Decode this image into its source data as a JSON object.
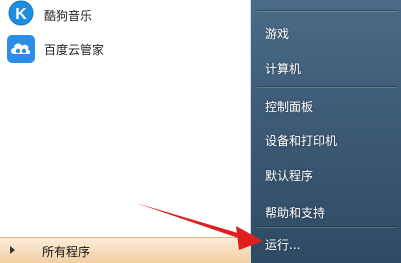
{
  "programs": [
    {
      "label": "酷狗音乐",
      "icon": "kugou-music-icon"
    },
    {
      "label": "百度云管家",
      "icon": "baidu-cloud-icon"
    }
  ],
  "all_programs": {
    "label": "所有程序",
    "icon": "triangle-right-icon"
  },
  "right_menu": [
    {
      "label": "游戏"
    },
    {
      "label": "计算机"
    },
    {
      "label": "控制面板"
    },
    {
      "label": "设备和打印机"
    },
    {
      "label": "默认程序"
    },
    {
      "label": "帮助和支持"
    },
    {
      "label": "运行..."
    }
  ],
  "colors": {
    "arrow": "#e01f1f",
    "right_panel": "#3e5b76",
    "all_programs_bg": "#f2cfa3"
  }
}
